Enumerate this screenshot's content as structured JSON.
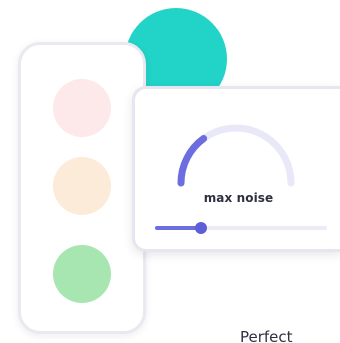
{
  "colors": {
    "teal_blob": "#22d3c8",
    "lamp_red": "#fde8ea",
    "lamp_amber": "#fdebd9",
    "lamp_green": "#a7e6b1",
    "gauge_fill": "#6b6de0",
    "gauge_track": "#e8e8f8",
    "slider_track": "#ececf7",
    "slider_fill": "#6b6de0"
  },
  "noise_card": {
    "label": "max noise",
    "gauge_level": 0.3,
    "slider_level": 0.27
  },
  "caption": "Perfect"
}
